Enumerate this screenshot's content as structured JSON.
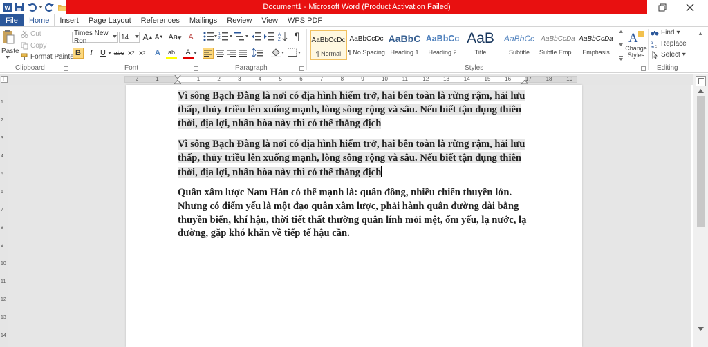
{
  "window": {
    "title": "Document1 - Microsoft Word (Product Activation Failed)",
    "minimize": "—",
    "restore": "❐",
    "close": "✕"
  },
  "qat": {
    "dropdown": "▾"
  },
  "tabs": [
    "File",
    "Home",
    "Insert",
    "Page Layout",
    "References",
    "Mailings",
    "Review",
    "View",
    "WPS PDF"
  ],
  "ribbon": {
    "clipboard": {
      "label": "Clipboard",
      "paste": "Paste",
      "cut": "Cut",
      "copy": "Copy",
      "format_painter": "Format Painter"
    },
    "font": {
      "label": "Font",
      "font_name": "Times New Ron",
      "font_size": "14",
      "grow": "A",
      "shrink": "A",
      "case": "Aa",
      "clear": "A",
      "bold": "B",
      "italic": "I",
      "underline": "U",
      "strike": "abc",
      "subscript": "x",
      "superscript": "x",
      "effects": "A",
      "highlight": "ab",
      "font_color": "A"
    },
    "paragraph": {
      "label": "Paragraph"
    },
    "styles": {
      "label": "Styles",
      "items": [
        {
          "sample": "AaBbCcDc",
          "name": "¶ Normal"
        },
        {
          "sample": "AaBbCcDc",
          "name": "¶ No Spacing"
        },
        {
          "sample": "AaBbC",
          "name": "Heading 1"
        },
        {
          "sample": "AaBbCc",
          "name": "Heading 2"
        },
        {
          "sample": "AaB",
          "name": "Title"
        },
        {
          "sample": "AaBbCc",
          "name": "Subtitle"
        },
        {
          "sample": "AaBbCcDa",
          "name": "Subtle Emp..."
        },
        {
          "sample": "AaBbCcDa",
          "name": "Emphasis"
        }
      ],
      "change_styles": "Change Styles"
    },
    "editing": {
      "label": "Editing",
      "find": "Find",
      "replace": "Replace",
      "select": "Select"
    }
  },
  "ruler": {
    "numbers": [
      "2",
      "1",
      "1",
      "2",
      "3",
      "4",
      "5",
      "6",
      "7",
      "8",
      "9",
      "10",
      "11",
      "12",
      "13",
      "14",
      "15",
      "16",
      "17",
      "18",
      "19"
    ],
    "vnumbers": [
      "1",
      "2",
      "3",
      "4",
      "5",
      "6",
      "7",
      "8",
      "9",
      "10",
      "11",
      "12",
      "13",
      "14"
    ]
  },
  "document": {
    "paragraphs": [
      "Vì sông Bạch Đằng là nơi có địa hình hiểm trở, hai bên toàn là rừng rậm, hải lưu thấp, thủy triều lên xuống mạnh, lòng sông rộng và sâu. Nếu biết tận dụng thiên thời, địa lợi, nhân hòa này thì có thể thắng địch",
      "Vì sông Bạch Đằng là nơi có địa hình hiểm trở, hai bên toàn là rừng rậm, hải lưu thấp, thủy triều lên xuống mạnh, lòng sông rộng và sâu. Nếu biết tận dụng thiên thời, địa lợi, nhân hòa này thì có thể thắng địch",
      "Quân xâm lược Nam Hán có thế mạnh là: quân đông, nhiều chiến thuyền lớn. Nhưng có điểm yếu là một đạo quân xâm lược, phải hành quân đường dài bằng thuyền biển, khí hậu, thời tiết thất thường quân lính mỏi mệt, ốm yếu, lạ nước, lạ đường, gặp khó khăn về tiếp tế hậu cần."
    ]
  },
  "colors": {
    "title_bar": "#e81010",
    "file_tab": "#2b579a",
    "selection_shading": "#e5e5e5"
  }
}
